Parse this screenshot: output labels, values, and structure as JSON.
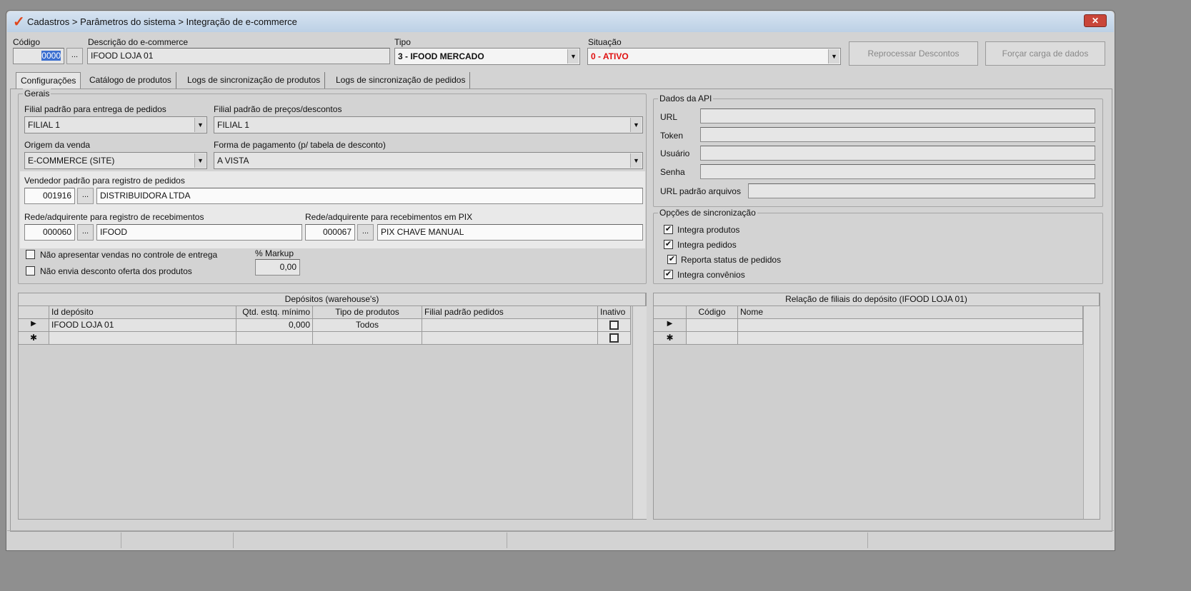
{
  "window": {
    "title": "Cadastros > Parâmetros do sistema >  Integração de e-commerce",
    "close_icon": "close-icon"
  },
  "header": {
    "codigo_label": "Código",
    "codigo_value": "0000",
    "descricao_label": "Descrição do e-commerce",
    "descricao_value": "IFOOD LOJA 01",
    "tipo_label": "Tipo",
    "tipo_value": "3 - IFOOD MERCADO",
    "situacao_label": "Situação",
    "situacao_value": "0 - ATIVO",
    "reprocessar_label": "Reprocessar Descontos",
    "forcar_label": "Forçar carga de dados",
    "dots": "..."
  },
  "tabs": [
    "Configurações",
    "Catálogo de produtos",
    "Logs de sincronização de produtos",
    "Logs de sincronização de pedidos"
  ],
  "gerais": {
    "title": "Gerais",
    "filial_entrega_label": "Filial padrão para entrega de pedidos",
    "filial_entrega_value": "FILIAL 1",
    "filial_precos_label": "Filial padrão de preços/descontos",
    "filial_precos_value": "FILIAL 1",
    "origem_label": "Origem da venda",
    "origem_value": "E-COMMERCE (SITE)",
    "forma_label": "Forma de pagamento (p/ tabela de desconto)",
    "forma_value": "A VISTA",
    "vendedor_label": "Vendedor padrão para registro de pedidos",
    "vendedor_code": "001916",
    "vendedor_name": "DISTRIBUIDORA LTDA",
    "rede_label": "Rede/adquirente para registro de recebimentos",
    "rede_code": "000060",
    "rede_name": "IFOOD",
    "pix_label": "Rede/adquirente para recebimentos em PIX",
    "pix_code": "000067",
    "pix_name": "PIX CHAVE MANUAL",
    "chk1_label": "Não apresentar vendas no controle de entrega",
    "chk2_label": "Não envia desconto oferta dos produtos",
    "markup_label": "% Markup",
    "markup_value": "0,00"
  },
  "api": {
    "title": "Dados da API",
    "url_label": "URL",
    "token_label": "Token",
    "usuario_label": "Usuário",
    "senha_label": "Senha",
    "url_arquivos_label": "URL padrão arquivos"
  },
  "sync": {
    "title": "Opções de sincronização",
    "options": [
      {
        "label": "Integra produtos",
        "checked": true
      },
      {
        "label": "Integra pedidos",
        "checked": true
      },
      {
        "label": "Reporta status de pedidos",
        "checked": true
      },
      {
        "label": "Integra convênios",
        "checked": true
      }
    ]
  },
  "depositos": {
    "title": "Depósitos (warehouse's)",
    "columns": [
      "Id depósito",
      "Qtd. estq. mínimo",
      "Tipo de produtos",
      "Filial padrão pedidos",
      "Inativo"
    ],
    "rows": [
      {
        "id": "IFOOD LOJA 01",
        "qtd": "0,000",
        "tipo": "Todos",
        "filial": ""
      }
    ]
  },
  "filiais": {
    "title": "Relação de filiais do depósito (IFOOD LOJA 01)",
    "columns": [
      "Código",
      "Nome"
    ]
  }
}
